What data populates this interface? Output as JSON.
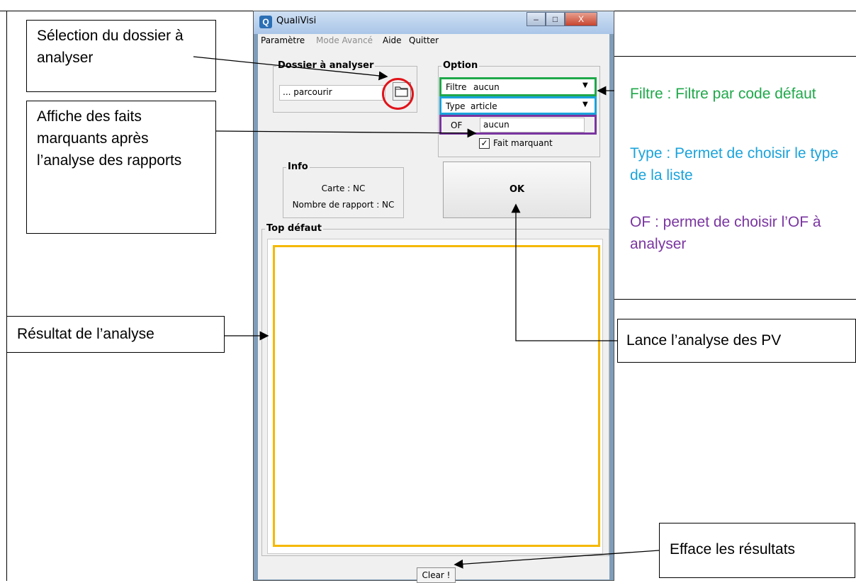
{
  "app": {
    "title": "QualiVisi",
    "icon_text": "Q",
    "window_controls": {
      "minimize": "–",
      "maximize": "□",
      "close": "X"
    }
  },
  "menu": {
    "items": [
      {
        "label": "Paramètre",
        "enabled": true
      },
      {
        "label": "Mode Avancé",
        "enabled": false
      },
      {
        "label": "Aide",
        "enabled": true
      },
      {
        "label": "Quitter",
        "enabled": true
      }
    ]
  },
  "folder_group": {
    "title": "Dossier à analyser",
    "path_value": "... parcourir",
    "browse_icon": "folder-icon"
  },
  "option_group": {
    "title": "Option",
    "filtre": {
      "label": "Filtre",
      "value": "aucun"
    },
    "type": {
      "label": "Type",
      "value": "article"
    },
    "of": {
      "label": "OF",
      "value": "aucun"
    },
    "fait_marquant": {
      "label": "Fait marquant",
      "checked": true,
      "mark": "✓"
    }
  },
  "info_group": {
    "title": "Info",
    "carte": "Carte : NC",
    "nombre_rapport": "Nombre de rapport : NC"
  },
  "ok_button": {
    "label": "OK"
  },
  "top_defaut": {
    "title": "Top défaut"
  },
  "clear_button": {
    "label": "Clear !"
  },
  "annotations": {
    "selection": "Sélection du dossier à analyser",
    "faits": "Affiche des faits marquants après l’analyse des rapports",
    "resultat": "Résultat de l’analyse",
    "lance": "Lance l’analyse des PV",
    "efface": "Efface les résultats",
    "filtre_note": "Filtre : Filtre par code défaut",
    "type_note": "Type : Permet de choisir le type de la liste",
    "of_note": "OF : permet de choisir l’OF à analyser"
  },
  "colors": {
    "filtre_frame": "#1fa84a",
    "type_frame": "#1aa3dc",
    "of_frame": "#7a35a0",
    "result_frame": "#f5b800",
    "browse_circle": "#e0141a"
  }
}
